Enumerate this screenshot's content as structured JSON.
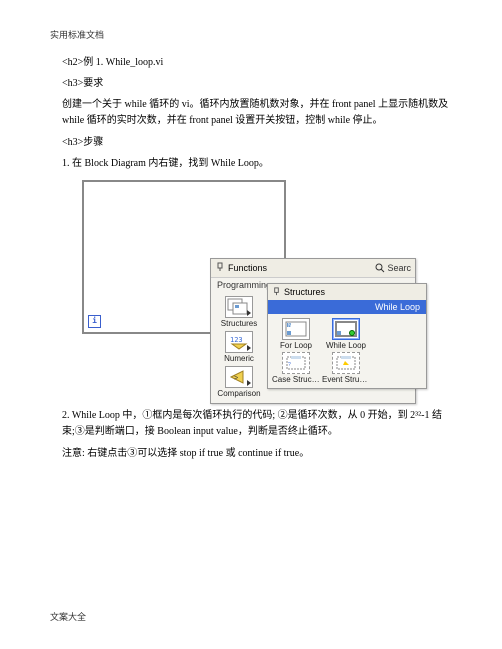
{
  "doc": {
    "header": "实用标准文档",
    "footer": "文案大全"
  },
  "h2": "<h2>例 1. While_loop.vi",
  "h3a": "<h3>要求",
  "req": "创建一个关于 while 循环的 vi。循环内放置随机数对象，并在 front panel 上显示随机数及 while 循环的实时次数，并在 front panel 设置开关按钮，控制 while 停止。",
  "h3b": "<h3>步骤",
  "step1": "1. 在 Block Diagram 内右键，找到 While Loop。",
  "step2": "2. While Loop 中，①框内是每次循环执行的代码; ②是循环次数，从 0 开始，到 2³²-1 结束;③是判断端口，接 Boolean input value，判断是否终止循环。",
  "note": "注意: 右键点击③可以选择 stop if true 或 continue if true。",
  "bd": {
    "i": "i"
  },
  "palette": {
    "title": "Functions",
    "search": "Searc",
    "category": "Programming",
    "items": [
      {
        "label": "Structures"
      },
      {
        "label": "Numeric"
      },
      {
        "label": "Comparison"
      }
    ]
  },
  "subpalette": {
    "title": "Structures",
    "highlight": "While Loop",
    "items": [
      {
        "label": "For Loop"
      },
      {
        "label": "While Loop"
      },
      {
        "label": "Case Structu..."
      },
      {
        "label": "Event Struct..."
      }
    ]
  }
}
